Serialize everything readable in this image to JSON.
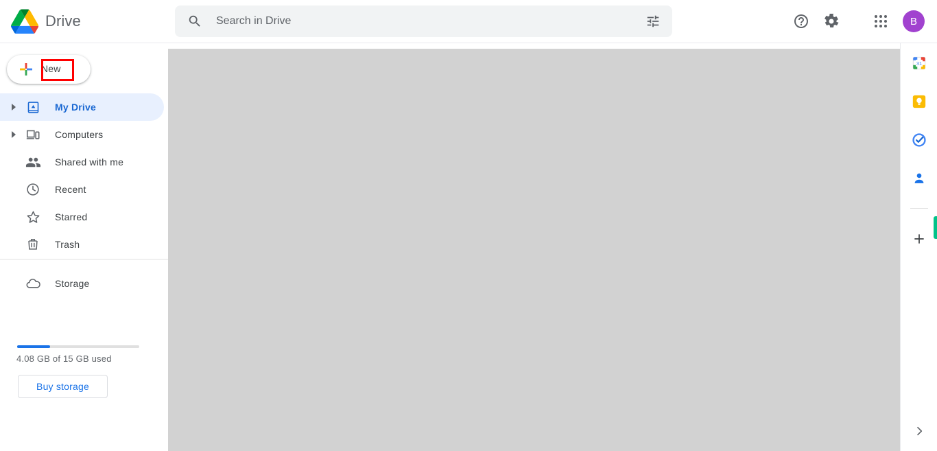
{
  "header": {
    "brand_title": "Drive",
    "logo_icon": "google-drive-logo",
    "search": {
      "placeholder": "Search in Drive",
      "value": "",
      "search_icon": "search-icon",
      "tune_icon": "tune-filter-icon"
    },
    "actions": [
      {
        "name": "support",
        "icon": "help-circle-icon",
        "label": "Support"
      },
      {
        "name": "settings",
        "icon": "gear-icon",
        "label": "Settings"
      },
      {
        "name": "google-apps",
        "icon": "apps-grid-icon",
        "label": "Google apps"
      }
    ],
    "avatar": {
      "initial": "B",
      "color": "#a142cf"
    }
  },
  "sidebar": {
    "new_button": {
      "label": "New",
      "icon": "plus-multicolor-icon"
    },
    "items": [
      {
        "label": "My Drive",
        "icon": "my-drive-icon",
        "expandable": true,
        "active": true
      },
      {
        "label": "Computers",
        "icon": "computers-icon",
        "expandable": true,
        "active": false
      },
      {
        "label": "Shared with me",
        "icon": "shared-people-icon",
        "expandable": false,
        "active": false
      },
      {
        "label": "Recent",
        "icon": "clock-icon",
        "expandable": false,
        "active": false
      },
      {
        "label": "Starred",
        "icon": "star-icon",
        "expandable": false,
        "active": false
      },
      {
        "label": "Trash",
        "icon": "trash-icon",
        "expandable": false,
        "active": false
      }
    ],
    "storage": {
      "label": "Storage",
      "icon": "cloud-icon",
      "usage_text": "4.08 GB of 15 GB used",
      "used_gb": 4.08,
      "total_gb": 15,
      "percent_used": 27,
      "buy_button_label": "Buy storage"
    }
  },
  "side_panel": {
    "apps": [
      {
        "name": "google-calendar",
        "icon": "calendar-31-icon"
      },
      {
        "name": "google-keep",
        "icon": "keep-bulb-icon"
      },
      {
        "name": "google-tasks",
        "icon": "tasks-check-icon"
      },
      {
        "name": "google-contacts",
        "icon": "contacts-person-icon"
      }
    ],
    "add_label": "Get add-ons",
    "add_icon": "plus-icon",
    "expand_icon": "chevron-right-icon",
    "accent_color": "#00c389"
  },
  "annotation": {
    "target": "New",
    "box_color": "#ff0000"
  },
  "main": {
    "placeholder_color": "#d2d2d2"
  }
}
